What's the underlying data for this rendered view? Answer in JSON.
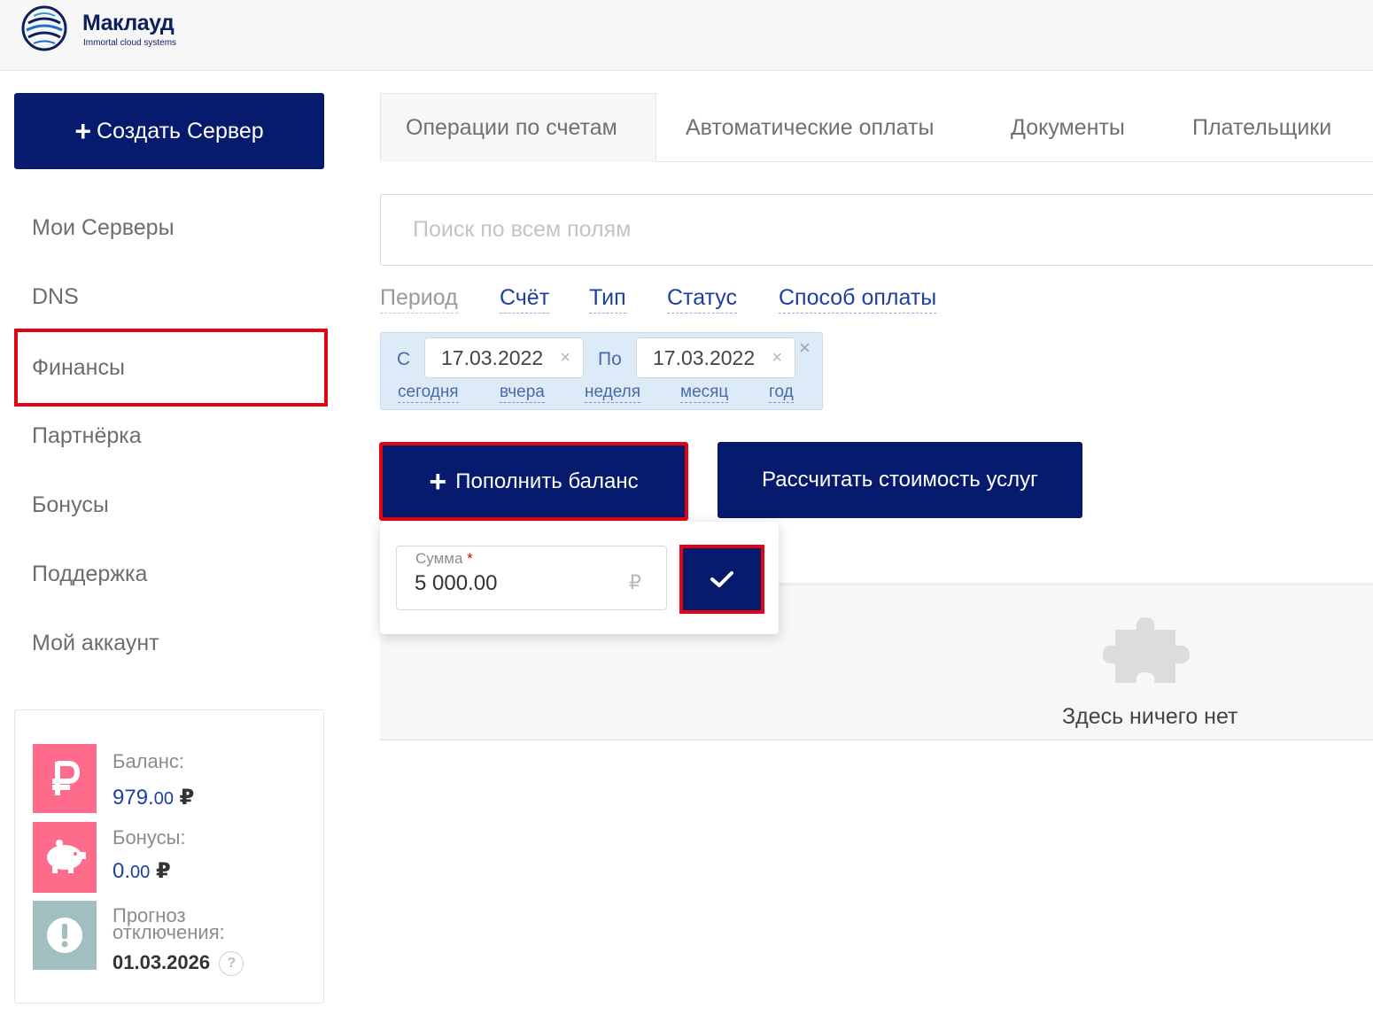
{
  "header": {
    "brand_name": "Маклауд",
    "brand_tagline": "Immortal cloud systems"
  },
  "sidebar": {
    "create_button": "Создать Сервер",
    "items": [
      {
        "label": "Мои Серверы",
        "active": false
      },
      {
        "label": "DNS",
        "active": false
      },
      {
        "label": "Финансы",
        "active": true
      },
      {
        "label": "Партнёрка",
        "active": false
      },
      {
        "label": "Бонусы",
        "active": false
      },
      {
        "label": "Поддержка",
        "active": false
      },
      {
        "label": "Мой аккаунт",
        "active": false
      }
    ]
  },
  "balance_card": {
    "balance_label": "Баланс:",
    "balance_whole": "979.",
    "balance_cents": "00",
    "bonuses_label": "Бонусы:",
    "bonuses_whole": "0.",
    "bonuses_cents": "00",
    "forecast_label_line1": "Прогноз",
    "forecast_label_line2": "отключения:",
    "forecast_date": "01.03.2026",
    "currency": "₽",
    "help": "?",
    "icons": [
      "ruble-icon",
      "piggy-bank-icon",
      "exclamation-icon"
    ],
    "colors": {
      "pink": "#fe6b8b",
      "gray_teal": "#a0bfbe"
    }
  },
  "tabs": [
    {
      "label": "Операции по счетам",
      "active": true
    },
    {
      "label": "Автоматические оплаты",
      "active": false
    },
    {
      "label": "Документы",
      "active": false
    },
    {
      "label": "Плательщики",
      "active": false
    }
  ],
  "search": {
    "placeholder": "Поиск по всем полям",
    "value": ""
  },
  "filters": [
    {
      "label": "Период",
      "active": false
    },
    {
      "label": "Счёт",
      "active": true
    },
    {
      "label": "Тип",
      "active": true
    },
    {
      "label": "Статус",
      "active": true
    },
    {
      "label": "Способ оплаты",
      "active": true
    }
  ],
  "period": {
    "from_label": "С",
    "from_date": "17.03.2022",
    "to_label": "По",
    "to_date": "17.03.2022",
    "clear_icon": "×",
    "quick": [
      "сегодня",
      "вчера",
      "неделя",
      "месяц",
      "год"
    ]
  },
  "actions": {
    "topup": "Пополнить баланс",
    "calculate": "Рассчитать стоимость услуг"
  },
  "topup_popup": {
    "amount_label": "Сумма",
    "required_mark": "*",
    "amount_value": "5 000.00",
    "currency": "₽",
    "confirm_icon": "check-icon"
  },
  "empty_state": {
    "text": "Здесь ничего нет",
    "icon": "puzzle-icon"
  },
  "colors": {
    "primary": "#061a6e",
    "link": "#1d3ea3",
    "highlight": "#e20613"
  }
}
